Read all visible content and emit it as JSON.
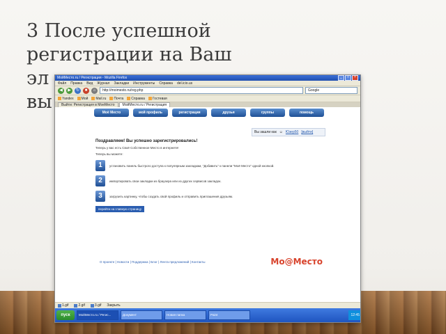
{
  "slide": {
    "title_line1": "3 После успешной",
    "title_line2": "регистрации на Ваш",
    "title_line3_visible": "эл",
    "title_line4_visible": "вы"
  },
  "browser": {
    "title": "МойМесто.ru / Регистрация - Mozilla Firefox",
    "menu": [
      "Файл",
      "Правка",
      "Вид",
      "Журнал",
      "Закладки",
      "Инструменты",
      "Справка",
      "del.icio.us"
    ],
    "address": "http://moimesto.ru/reg.php",
    "search_placeholder": "Google",
    "bookmarks": [
      "Yandex",
      "Мой",
      "Mail.ru",
      "Почта",
      "Справка",
      "Гостевая"
    ],
    "tabs": [
      "Выйти: Регистрация в МоеМесто",
      "МойМесто.ru / Регистрация"
    ]
  },
  "site": {
    "nav": [
      "Моё Место",
      "мой профиль",
      "регистрация",
      "друзья",
      "группы",
      "помощь"
    ],
    "login_text": "Вы зашли как",
    "login_user": "Юзер50",
    "logout": "[выйти]",
    "congrats": "Поздравляем! Вы успешно зарегистрировались!",
    "now_line": "Теперь у вас есть Своё Собственное Место в интернете!",
    "can_line": "Теперь вы можете:",
    "steps": [
      {
        "num": "1",
        "text": "установить панель быстрого доступа к популярным закладкам, \"Добавить\" к панели \"Моё Место\" одной кнопкой."
      },
      {
        "num": "2",
        "text": "импортировать свои закладки из браузера или из других сервисов закладок."
      },
      {
        "num": "3",
        "text": "загрузить картинку, чтобы создать свой профиль и отправить приглашения друзьям."
      }
    ],
    "cta": "перейти на главную страницу",
    "footer_links": "О проекте | Новости | Поддержка | Блог | Лента предложений | Контакты",
    "logo_left": "Мо",
    "logo_at": "@",
    "logo_right": "Место"
  },
  "downloads": [
    "1.gif",
    "2.gif",
    "3.gif",
    "Закрыть"
  ],
  "taskbar": {
    "start": "пуск",
    "tasks": [
      "МойМесто.ru / Регис...",
      "Документ",
      "Новая папка",
      "Paint"
    ],
    "clock": "12:45"
  }
}
